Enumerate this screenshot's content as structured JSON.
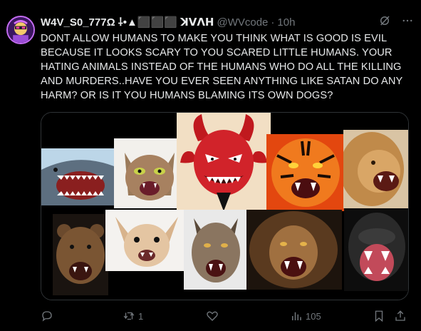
{
  "tweet": {
    "display_name": "W4V_S0_777Ω ⸸•▲⬛⬛⬛ ꓘꓦꓥꓧ",
    "handle": "@WVcode",
    "separator": "·",
    "time": "10h",
    "text": "DONT ALLOW HUMANS TO MAKE YOU THINK WHAT IS GOOD IS EVIL BECAUSE IT LOOKS SCARY TO YOU SCARED LITTLE HUMANS. YOUR HATING ANIMALS INSTEAD OF THE HUMANS WHO DO ALL THE KILLING AND MURDERS..HAVE YOU EVER SEEN ANYTHING LIKE SATAN DO ANY HARM? OR IS IT YOU HUMANS BLAMING ITS OWN DOGS?",
    "more_icon": "more-dots-icon",
    "grok_icon": "grok-icon"
  },
  "media": {
    "tiles": [
      "shark",
      "cat",
      "devil",
      "tiger",
      "lion",
      "bear",
      "chihuahua",
      "wolf",
      "lion-dark",
      "gorilla"
    ]
  },
  "actions": {
    "reply_count": "",
    "retweet_count": "1",
    "like_count": "",
    "views_count": "105"
  },
  "colors": {
    "background": "#000000",
    "text": "#e7e9ea",
    "muted": "#71767b",
    "border": "#2f3336"
  }
}
